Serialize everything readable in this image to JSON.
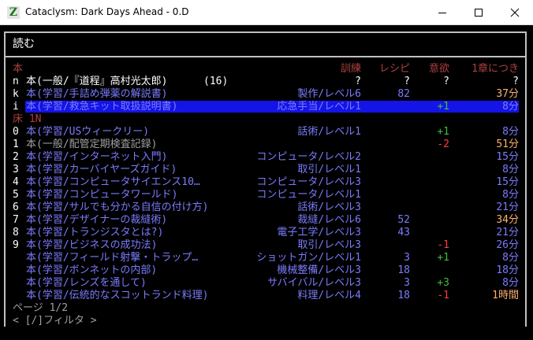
{
  "window": {
    "title": "Cataclysm: Dark Days Ahead - 0.D",
    "icon_glyph": "Z"
  },
  "menu": {
    "title": "読む",
    "header": {
      "section": "本",
      "col_train": "訓練",
      "col_recipe": "レシピ",
      "col_morale": "意欲",
      "col_time": "1章につき"
    },
    "selected": {
      "key": "n",
      "name": "本(一般/『道程』高村光太郎)",
      "count": "(16)",
      "train": "?",
      "recipe": "?",
      "morale": "?",
      "time": "?"
    },
    "inventory_items": [
      {
        "key": "k",
        "name": "本(学習/手詰め弾薬の解説書)",
        "skill": "製作/レベル6",
        "recipe": "82",
        "morale": "",
        "morale_color": "",
        "time": "37分",
        "time_color": "or"
      },
      {
        "key": "i",
        "name": "本(学習/救急キット取扱説明書)",
        "skill": "応急手当/レベル1",
        "recipe": "",
        "morale": "+1",
        "morale_color": "gr",
        "time": "8分",
        "time_color": "bl"
      }
    ],
    "floor_header": "床 1N",
    "floor_items": [
      {
        "key": "0",
        "name": "本(学習/USウィークリー)",
        "name_color": "bl",
        "skill": "話術/レベル1",
        "recipe": "",
        "morale": "+1",
        "morale_color": "gr",
        "time": "8分",
        "time_color": "bl"
      },
      {
        "key": "1",
        "name": "本(一般/配管定期検査記録)",
        "name_color": "gy",
        "skill": "",
        "recipe": "",
        "morale": "-2",
        "morale_color": "rd",
        "time": "51分",
        "time_color": "or"
      },
      {
        "key": "2",
        "name": "本(学習/インターネット入門)",
        "name_color": "bl",
        "skill": "コンピュータ/レベル2",
        "recipe": "",
        "morale": "",
        "morale_color": "",
        "time": "15分",
        "time_color": "bl"
      },
      {
        "key": "3",
        "name": "本(学習/カーバイヤーズガイド)",
        "name_color": "bl",
        "skill": "取引/レベル1",
        "recipe": "",
        "morale": "",
        "morale_color": "",
        "time": "8分",
        "time_color": "bl"
      },
      {
        "key": "4",
        "name": "本(学習/コンピュータサイエンス10…",
        "name_color": "bl",
        "skill": "コンピュータ/レベル3",
        "recipe": "",
        "morale": "",
        "morale_color": "",
        "time": "15分",
        "time_color": "bl"
      },
      {
        "key": "5",
        "name": "本(学習/コンピュータワールド)",
        "name_color": "bl",
        "skill": "コンピュータ/レベル1",
        "recipe": "",
        "morale": "",
        "morale_color": "",
        "time": "8分",
        "time_color": "bl"
      },
      {
        "key": "6",
        "name": "本(学習/サルでも分かる自信の付け方)",
        "name_color": "bl",
        "skill": "話術/レベル3",
        "recipe": "",
        "morale": "",
        "morale_color": "",
        "time": "21分",
        "time_color": "bl"
      },
      {
        "key": "7",
        "name": "本(学習/デザイナーの裁縫術)",
        "name_color": "bl",
        "skill": "裁縫/レベル6",
        "recipe": "52",
        "morale": "",
        "morale_color": "",
        "time": "34分",
        "time_color": "or"
      },
      {
        "key": "8",
        "name": "本(学習/トランジスタとは?)",
        "name_color": "bl",
        "skill": "電子工学/レベル3",
        "recipe": "43",
        "morale": "",
        "morale_color": "",
        "time": "21分",
        "time_color": "bl"
      },
      {
        "key": "9",
        "name": "本(学習/ビジネスの成功法)",
        "name_color": "bl",
        "skill": "取引/レベル3",
        "recipe": "",
        "morale": "-1",
        "morale_color": "rd",
        "time": "26分",
        "time_color": "bl"
      },
      {
        "key": "",
        "name": "本(学習/フィールド射撃・トラップ…",
        "name_color": "bl",
        "skill": "ショットガン/レベル1",
        "recipe": "3",
        "morale": "+1",
        "morale_color": "gr",
        "time": "8分",
        "time_color": "bl"
      },
      {
        "key": "",
        "name": "本(学習/ボンネットの内部)",
        "name_color": "bl",
        "skill": "機械整備/レベル3",
        "recipe": "18",
        "morale": "",
        "morale_color": "",
        "time": "18分",
        "time_color": "bl"
      },
      {
        "key": "",
        "name": "本(学習/レンズを通して)",
        "name_color": "bl",
        "skill": "サバイバル/レベル3",
        "recipe": "3",
        "morale": "+3",
        "morale_color": "gr",
        "time": "8分",
        "time_color": "bl"
      },
      {
        "key": "",
        "name": "本(学習/伝統的なスコットランド料理)",
        "name_color": "bl",
        "skill": "料理/レベル4",
        "recipe": "18",
        "morale": "-1",
        "morale_color": "rd",
        "time": "1時間",
        "time_color": "or"
      }
    ],
    "page": "ページ 1/2",
    "filter": "< [/]フィルタ >"
  }
}
